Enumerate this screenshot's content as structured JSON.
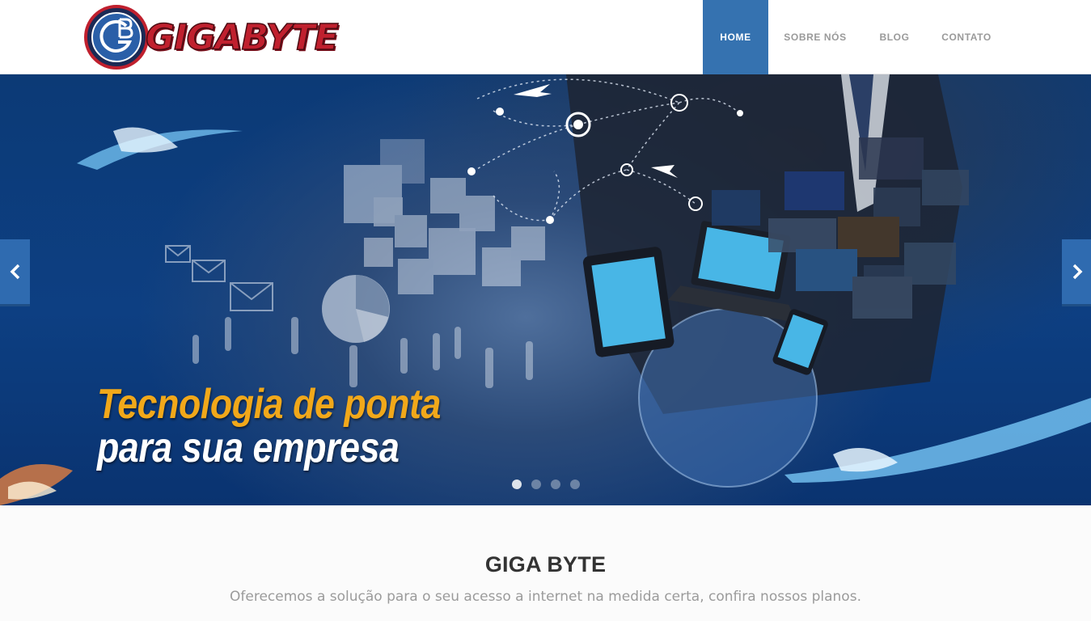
{
  "brand": {
    "badge_letters": "GB",
    "name": "GIGABYTE",
    "colors": {
      "red": "#c0202e",
      "navy": "#1b2a55"
    }
  },
  "nav": {
    "items": [
      {
        "label": "HOME",
        "active": true
      },
      {
        "label": "SOBRE NÓS",
        "active": false
      },
      {
        "label": "BLOG",
        "active": false
      },
      {
        "label": "CONTATO",
        "active": false
      }
    ],
    "active_color": "#3572b0"
  },
  "slider": {
    "tagline_line1": "Tecnologia de ponta",
    "tagline_line2": "para sua empresa",
    "tagline_colors": {
      "line1": "#f1a81a",
      "line2": "#ffffff"
    },
    "prev_icon": "chevron-left-icon",
    "next_icon": "chevron-right-icon",
    "slide_count": 4,
    "active_slide": 1
  },
  "intro": {
    "title": "GIGA BYTE",
    "text": "Oferecemos a solução para o seu acesso a internet na medida certa, confira nossos planos."
  }
}
